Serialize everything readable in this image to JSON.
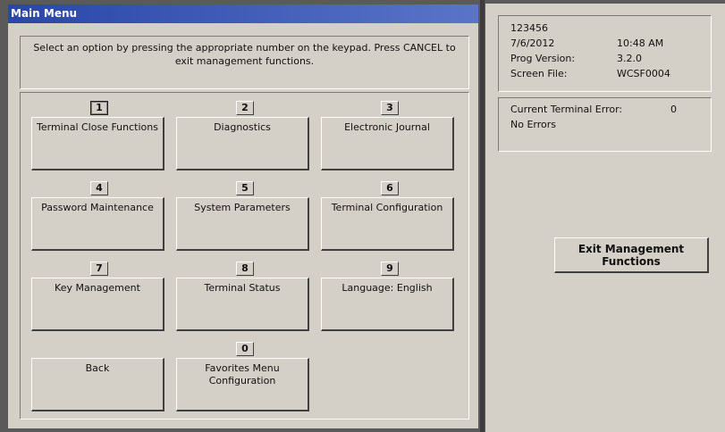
{
  "title": "Main Menu",
  "instructions": "Select an option by pressing the appropriate number on the keypad.  Press CANCEL to exit management functions.",
  "options": [
    {
      "key": "1",
      "label": "Terminal Close Functions",
      "selected": true
    },
    {
      "key": "2",
      "label": "Diagnostics"
    },
    {
      "key": "3",
      "label": "Electronic Journal"
    },
    {
      "key": "4",
      "label": "Password Maintenance"
    },
    {
      "key": "5",
      "label": "System Parameters"
    },
    {
      "key": "6",
      "label": "Terminal Configuration"
    },
    {
      "key": "7",
      "label": "Key Management"
    },
    {
      "key": "8",
      "label": "Terminal Status"
    },
    {
      "key": "9",
      "label": "Language: English"
    },
    {
      "key": "0",
      "label": "Favorites Menu Configuration"
    }
  ],
  "back": {
    "label": "Back"
  },
  "info": {
    "terminal_id": "123456",
    "date": "7/6/2012",
    "time": "10:48 AM",
    "prog_version_label": "Prog Version:",
    "prog_version": "3.2.0",
    "screen_file_label": "Screen File:",
    "screen_file": "WCSF0004"
  },
  "error": {
    "label": "Current Terminal Error:",
    "code": "0",
    "message": "No Errors"
  },
  "exit_button": {
    "label": "Exit Management Functions"
  },
  "colors": {
    "titlebar": "#2a46a8",
    "panel": "#d4d0c8",
    "background": "#5a5a5a"
  }
}
